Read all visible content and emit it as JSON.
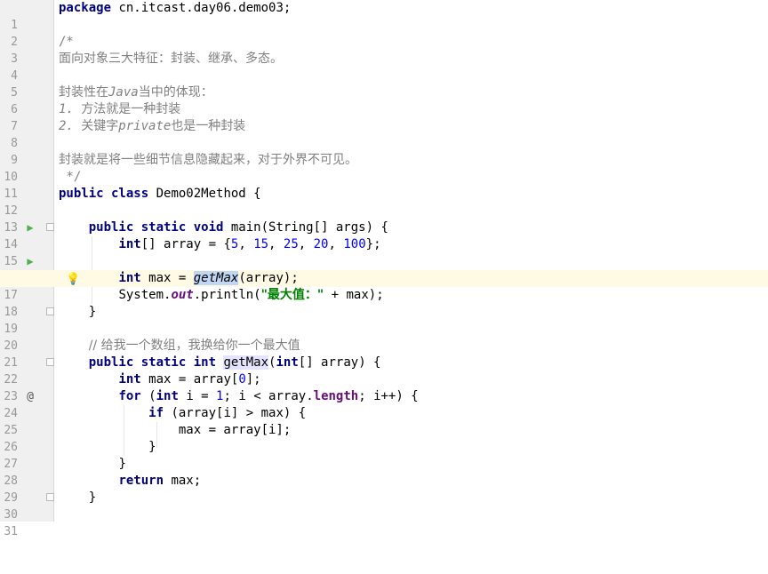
{
  "colors": {
    "keyword": "#000080",
    "number": "#0000ff",
    "string": "#008000",
    "comment": "#808080",
    "field": "#660e7a",
    "current_line": "#fffae3",
    "selection": "#c0d6f5"
  },
  "icons": {
    "run": "run-icon",
    "override": "override-icon",
    "bulb": "lightbulb-icon"
  },
  "code": {
    "l1_kw": "package",
    "l1_rest": " cn.itcast.day06.demo03;",
    "l3": "/*",
    "l4": "面向对象三大特征：封装、继承、多态。",
    "l6a": "封装性在",
    "l6b": "Java",
    "l6c": "当中的体现：",
    "l7a": "1. ",
    "l7b": "方法就是一种封装",
    "l8a": "2. ",
    "l8b": "关键字",
    "l8c": "private",
    "l8d": "也是一种封装",
    "l10": "封装就是将一些细节信息隐藏起来，对于外界不可见。",
    "l11": " */",
    "l12_kw": "public class",
    "l12_rest": " Demo02Method {",
    "l14_kw": "public static void",
    "l14_rest": " main(String[] args) {",
    "l15_kw": "int",
    "l15_a": "[] array = {",
    "l15_n1": "5",
    "l15_n2": "15",
    "l15_n3": "25",
    "l15_n4": "20",
    "l15_n5": "100",
    "l15_end": "};",
    "comma": ", ",
    "l17_kw": "int",
    "l17_a": " max = ",
    "l17_sel": "getMax",
    "l17_b": "(array);",
    "l18_a": "System.",
    "l18_out": "out",
    "l18_b": ".println(",
    "l18_str": "\"最大值：\"",
    "l18_c": " + max);",
    "close_brace": "}",
    "l21": "// 给我一个数组，我换给你一个最大值",
    "l22_kw1": "public static int",
    "l22_sp": " ",
    "l22_name": "getMax",
    "l22_a": "(",
    "l22_kw2": "int",
    "l22_b": "[] array) {",
    "l23_kw": "int",
    "l23_a": " max = array[",
    "l23_n": "0",
    "l23_b": "];",
    "l24_kw1": "for",
    "l24_a": " (",
    "l24_kw2": "int",
    "l24_b": " i = ",
    "l24_n": "1",
    "l24_c": "; i < array.",
    "l24_len": "length",
    "l24_d": "; i++) {",
    "l25_kw": "if",
    "l25_rest": " (array[i] > max) {",
    "l26": "max = array[i];",
    "l29_kw": "return",
    "l29_rest": " max;"
  }
}
